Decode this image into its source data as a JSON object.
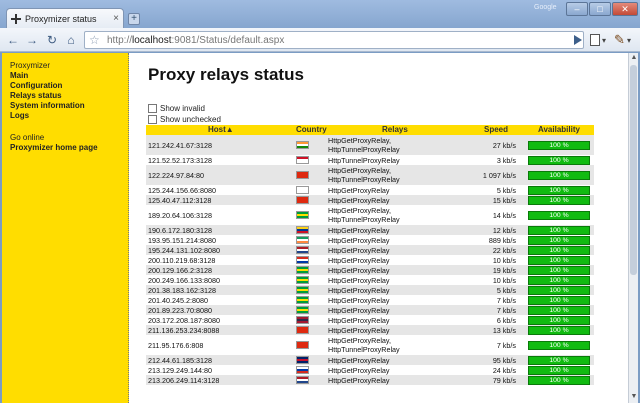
{
  "window": {
    "tab_title": "Proxymizer status",
    "tab_close": "×",
    "new_tab": "+",
    "profile_label": "Google",
    "min": "–",
    "max": "□",
    "close": "✕"
  },
  "toolbar": {
    "back": "←",
    "forward": "→",
    "reload": "↻",
    "home": "⌂",
    "url_scheme": "http://",
    "url_host": "localhost",
    "url_rest": ":9081/Status/default.aspx"
  },
  "sidebar": {
    "items": [
      "Proxymizer",
      "Main",
      "Configuration",
      "Relays status",
      "System information",
      "Logs"
    ],
    "items2": [
      "Go online",
      "Proxymizer home page"
    ]
  },
  "page": {
    "title": "Proxy relays status",
    "show_invalid": "Show invalid",
    "show_unchecked": "Show unchecked"
  },
  "grid": {
    "headers": {
      "host": "Host▲",
      "country": "Country",
      "relays": "Relays",
      "speed": "Speed",
      "availability": "Availability"
    },
    "rows": [
      {
        "host": "121.242.41.67:3128",
        "flag": "in",
        "relay1": "HttpGetProxyRelay,",
        "relay2": "HttpTunnelProxyRelay",
        "speed": "27 kb/s",
        "avail": "100 %"
      },
      {
        "host": "121.52.52.173:3128",
        "flag": "id",
        "relay1": "HttpTunnelProxyRelay",
        "relay2": "",
        "speed": "3 kb/s",
        "avail": "100 %"
      },
      {
        "host": "122.224.97.84:80",
        "flag": "cn",
        "relay1": "HttpGetProxyRelay,",
        "relay2": "HttpTunnelProxyRelay",
        "speed": "1 097 kb/s",
        "avail": "100 %"
      },
      {
        "host": "125.244.156.66:8080",
        "flag": "kr",
        "relay1": "HttpGetProxyRelay",
        "relay2": "",
        "speed": "5 kb/s",
        "avail": "100 %"
      },
      {
        "host": "125.40.47.112:3128",
        "flag": "cn",
        "relay1": "HttpGetProxyRelay",
        "relay2": "",
        "speed": "15 kb/s",
        "avail": "100 %"
      },
      {
        "host": "189.20.64.106:3128",
        "flag": "br",
        "relay1": "HttpGetProxyRelay,",
        "relay2": "HttpTunnelProxyRelay",
        "speed": "14 kb/s",
        "avail": "100 %"
      },
      {
        "host": "190.6.172.180:3128",
        "flag": "co",
        "relay1": "HttpGetProxyRelay",
        "relay2": "",
        "speed": "12 kb/s",
        "avail": "100 %"
      },
      {
        "host": "193.95.151.214:8080",
        "flag": "ie",
        "relay1": "HttpGetProxyRelay",
        "relay2": "",
        "speed": "889 kb/s",
        "avail": "100 %"
      },
      {
        "host": "195.244.131.102:8080",
        "flag": "nl",
        "relay1": "HttpGetProxyRelay",
        "relay2": "",
        "speed": "22 kb/s",
        "avail": "100 %"
      },
      {
        "host": "200.110.219.68:3128",
        "flag": "py",
        "relay1": "HttpGetProxyRelay",
        "relay2": "",
        "speed": "10 kb/s",
        "avail": "100 %"
      },
      {
        "host": "200.129.166.2:3128",
        "flag": "br",
        "relay1": "HttpGetProxyRelay",
        "relay2": "",
        "speed": "19 kb/s",
        "avail": "100 %"
      },
      {
        "host": "200.249.166.133:8080",
        "flag": "br",
        "relay1": "HttpGetProxyRelay",
        "relay2": "",
        "speed": "10 kb/s",
        "avail": "100 %"
      },
      {
        "host": "201.38.183.162:3128",
        "flag": "br",
        "relay1": "HttpGetProxyRelay",
        "relay2": "",
        "speed": "5 kb/s",
        "avail": "100 %"
      },
      {
        "host": "201.40.245.2:8080",
        "flag": "br",
        "relay1": "HttpGetProxyRelay",
        "relay2": "",
        "speed": "7 kb/s",
        "avail": "100 %"
      },
      {
        "host": "201.89.223.70:8080",
        "flag": "br",
        "relay1": "HttpGetProxyRelay",
        "relay2": "",
        "speed": "7 kb/s",
        "avail": "100 %"
      },
      {
        "host": "203.172.208.187:8080",
        "flag": "th",
        "relay1": "HttpGetProxyRelay",
        "relay2": "",
        "speed": "6 kb/s",
        "avail": "100 %"
      },
      {
        "host": "211.136.253.234:8088",
        "flag": "cn",
        "relay1": "HttpGetProxyRelay",
        "relay2": "",
        "speed": "13 kb/s",
        "avail": "100 %"
      },
      {
        "host": "211.95.176.6:808",
        "flag": "cn",
        "relay1": "HttpGetProxyRelay,",
        "relay2": "HttpTunnelProxyRelay",
        "speed": "7 kb/s",
        "avail": "100 %"
      },
      {
        "host": "212.44.61.185:3128",
        "flag": "gb",
        "relay1": "HttpGetProxyRelay",
        "relay2": "",
        "speed": "95 kb/s",
        "avail": "100 %"
      },
      {
        "host": "213.129.249.144:80",
        "flag": "ru",
        "relay1": "HttpGetProxyRelay",
        "relay2": "",
        "speed": "24 kb/s",
        "avail": "100 %"
      },
      {
        "host": "213.206.249.114:3128",
        "flag": "nl",
        "relay1": "HttpGetProxyRelay",
        "relay2": "",
        "speed": "79 kb/s",
        "avail": "100 %"
      }
    ]
  },
  "flag_colors": {
    "in": [
      "#ff9933",
      "#ffffff",
      "#138808"
    ],
    "id": [
      "#ce1126",
      "#ffffff",
      "#ffffff"
    ],
    "cn": [
      "#de2910",
      "#de2910",
      "#de2910"
    ],
    "kr": [
      "#ffffff",
      "#ffffff",
      "#ffffff"
    ],
    "br": [
      "#009c3b",
      "#ffdf00",
      "#009c3b"
    ],
    "co": [
      "#fcd116",
      "#003893",
      "#ce1126"
    ],
    "ie": [
      "#169b62",
      "#ffffff",
      "#ff883e"
    ],
    "nl": [
      "#ae1c28",
      "#ffffff",
      "#21468b"
    ],
    "py": [
      "#d52b1e",
      "#ffffff",
      "#0038a8"
    ],
    "th": [
      "#a51931",
      "#2d2a4a",
      "#a51931"
    ],
    "gb": [
      "#012169",
      "#c8102e",
      "#012169"
    ],
    "ru": [
      "#ffffff",
      "#0039a6",
      "#d52b1e"
    ]
  }
}
